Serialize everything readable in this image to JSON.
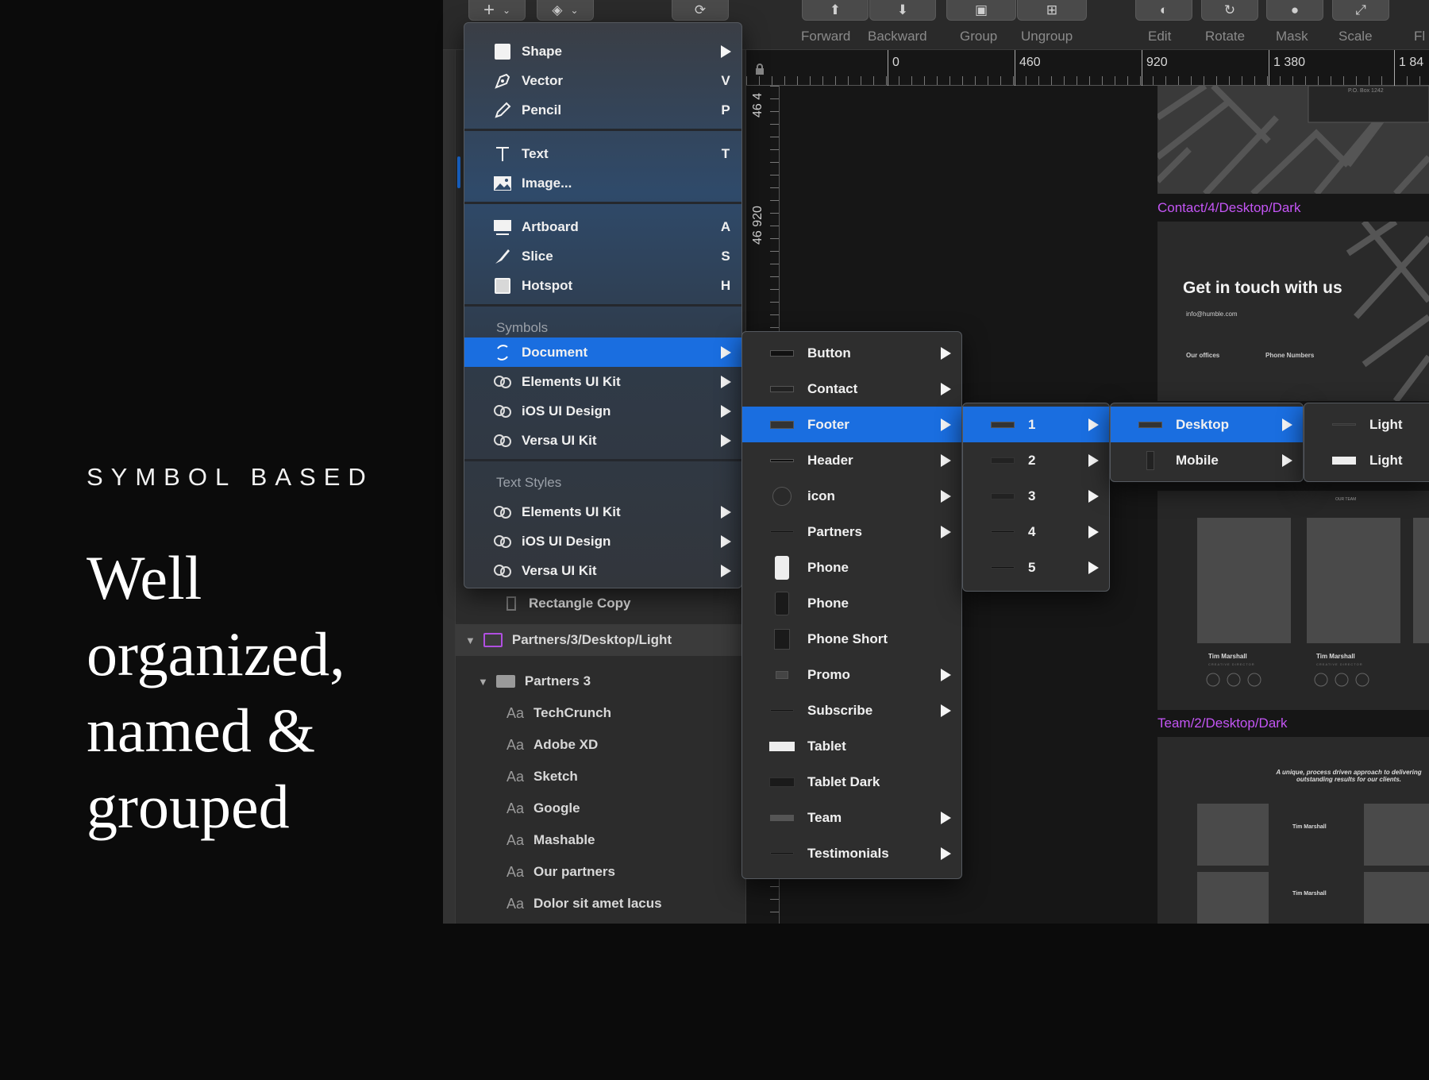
{
  "marketing": {
    "eyebrow": "SYMBOL BASED",
    "headline": [
      "Well",
      "organized,",
      "named &",
      "grouped"
    ]
  },
  "toolbar": {
    "labels": [
      "Forward",
      "Backward",
      "Group",
      "Ungroup",
      "Edit",
      "Rotate",
      "Mask",
      "Scale",
      "Fl"
    ]
  },
  "ruler": {
    "top": [
      "0",
      "460",
      "920",
      "1 380",
      "1 84"
    ],
    "left": [
      "46 4",
      "46 920"
    ]
  },
  "insert_menu": {
    "items": [
      {
        "label": "Shape",
        "key": "",
        "icon": "square-icon",
        "submenu": true
      },
      {
        "label": "Vector",
        "key": "V",
        "icon": "pen-icon"
      },
      {
        "label": "Pencil",
        "key": "P",
        "icon": "pencil-icon"
      },
      {
        "label": "Text",
        "key": "T",
        "icon": "text-icon"
      },
      {
        "label": "Image...",
        "key": "",
        "icon": "image-icon"
      },
      {
        "label": "Artboard",
        "key": "A",
        "icon": "artboard-icon"
      },
      {
        "label": "Slice",
        "key": "S",
        "icon": "slice-icon"
      },
      {
        "label": "Hotspot",
        "key": "H",
        "icon": "hotspot-icon"
      }
    ],
    "symbols_header": "Symbols",
    "symbols": [
      "Document",
      "Elements UI Kit",
      "iOS UI Design",
      "Versa UI Kit"
    ],
    "text_styles_header": "Text Styles",
    "text_styles": [
      "Elements UI Kit",
      "iOS UI Design",
      "Versa UI Kit"
    ]
  },
  "document_menu": {
    "items": [
      "Button",
      "Contact",
      "Footer",
      "Header",
      "icon",
      "Partners",
      "Phone",
      "Phone",
      "Phone Short",
      "Promo",
      "Subscribe",
      "Tablet",
      "Tablet Dark",
      "Team",
      "Testimonials"
    ],
    "selected": "Footer"
  },
  "footer_menu": {
    "items": [
      "1",
      "2",
      "3",
      "4",
      "5"
    ],
    "selected": "1"
  },
  "platform_menu": {
    "items": [
      "Desktop",
      "Mobile"
    ],
    "selected": "Desktop"
  },
  "theme_menu": {
    "items": [
      "Light",
      "Light"
    ]
  },
  "layers": {
    "rectangle_copy": "Rectangle Copy",
    "artboard": "Partners/3/Desktop/Light",
    "group": "Partners 3",
    "aa": "Aa",
    "texts": [
      "TechCrunch",
      "Adobe XD",
      "Sketch",
      "Google",
      "Mashable",
      "Our partners",
      "Dolor sit amet lacus"
    ]
  },
  "canvas": {
    "contact_label": "Contact/4/Desktop/Dark",
    "contact_heading": "Get in touch with us",
    "contact_email": "info@humble.com",
    "contact_offices": "Our offices",
    "contact_phones": "Phone Numbers",
    "team_label": "Team/2/Desktop/Dark",
    "team_header": "OUR TEAM",
    "member_name": "Tim Marshall",
    "member_role": "CREATIVE DIRECTOR",
    "tagline": "A unique, process driven approach to delivering outstanding results for our clients.",
    "po_box": "P.O. Box 1242"
  }
}
